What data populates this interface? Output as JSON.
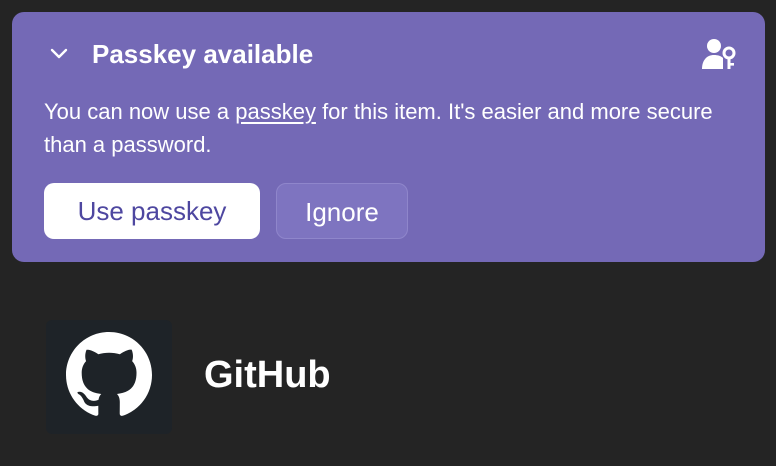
{
  "banner": {
    "title": "Passkey available",
    "message_before": "You can now use a ",
    "message_link": "passkey",
    "message_after": " for this item. It's easier and more secure than a password.",
    "primary_button": "Use passkey",
    "secondary_button": "Ignore",
    "icons": {
      "collapse": "chevron-down-icon",
      "passkey": "user-key-icon"
    },
    "colors": {
      "background": "#7469b6",
      "primary_button_text": "#4e47a0"
    }
  },
  "item": {
    "name": "GitHub",
    "icon": "github-icon"
  },
  "colors": {
    "page_background": "#242424"
  }
}
